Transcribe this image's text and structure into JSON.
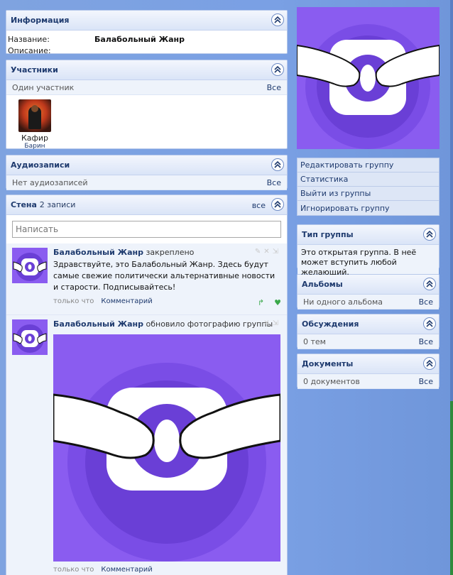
{
  "info": {
    "title": "Информация",
    "name_label": "Название:",
    "name_value": "Балабольный Жанр",
    "description_label": "Описание:"
  },
  "members": {
    "title": "Участники",
    "count_text": "Один участник",
    "all_link": "Все",
    "list": [
      {
        "name": "Кафир",
        "subtitle": "Барин"
      }
    ]
  },
  "audio": {
    "title": "Аудиозаписи",
    "empty_text": "Нет аудиозаписей",
    "all_link": "Все"
  },
  "wall": {
    "title": "Стена",
    "count": "2 записи",
    "all_link": "все",
    "input_placeholder": "Написать",
    "posts": [
      {
        "author": "Балабольный Жанр",
        "action": "закреплено",
        "text": "Здравствуйте, это Балабольный Жанр. Здесь будут самые свежие политически альтернативные новости и старости. Подписывайтесь!",
        "time": "только что",
        "comment_link": "Комментарий"
      },
      {
        "author": "Балабольный Жанр",
        "action": "обновило фотографию группы",
        "time": "только что",
        "comment_link": "Комментарий"
      }
    ]
  },
  "side_menu": [
    "Редактировать группу",
    "Статистика",
    "Выйти из группы",
    "Игнорировать группу"
  ],
  "group_type": {
    "title": "Тип группы",
    "text": "Это открытая группа. В неё может вступить любой желающий."
  },
  "albums": {
    "title": "Альбомы",
    "empty_text": "Ни одного альбома",
    "all_link": "Все"
  },
  "discussions": {
    "title": "Обсуждения",
    "empty_text": "0 тем",
    "all_link": "Все"
  },
  "documents": {
    "title": "Документы",
    "empty_text": "0 документов",
    "all_link": "Все"
  },
  "colors": {
    "accent": "#8a5cf0",
    "accent_dark": "#6a3fd6",
    "link": "#1e3a6e"
  },
  "icons": {
    "collapse": "chevron-up-double-icon",
    "share": "share-icon",
    "like": "heart-icon",
    "edit": "pencil-icon",
    "delete": "close-icon",
    "pin": "pin-icon",
    "logo": "handshake-logo-icon"
  }
}
